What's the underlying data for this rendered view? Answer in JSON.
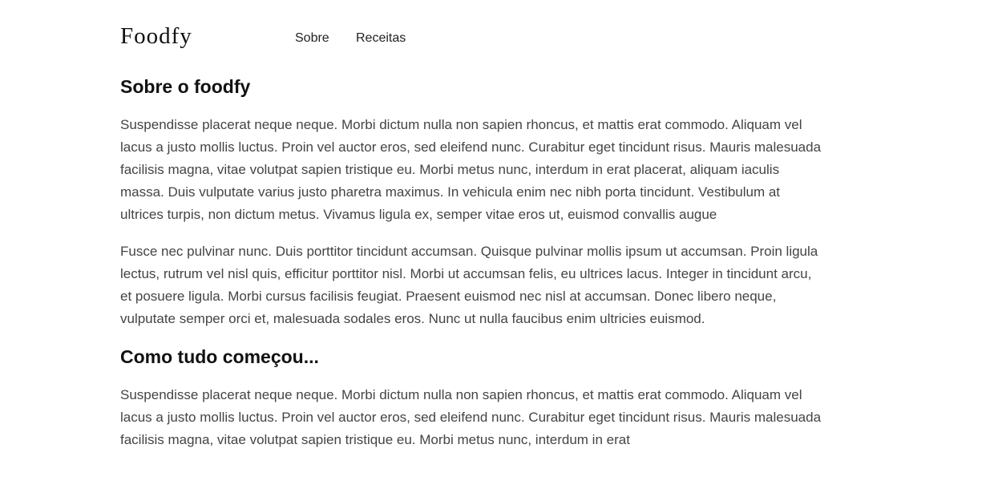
{
  "header": {
    "logo": "Foodfy",
    "nav": {
      "about": "Sobre",
      "recipes": "Receitas"
    }
  },
  "main": {
    "about_title": "Sobre o foodfy",
    "about_paragraphs": [
      "Suspendisse placerat neque neque. Morbi dictum nulla non sapien rhoncus, et mattis erat commodo. Aliquam vel lacus a justo mollis luctus. Proin vel auctor eros, sed eleifend nunc. Curabitur eget tincidunt risus. Mauris malesuada facilisis magna, vitae volutpat sapien tristique eu. Morbi metus nunc, interdum in erat placerat, aliquam iaculis massa. Duis vulputate varius justo pharetra maximus. In vehicula enim nec nibh porta tincidunt. Vestibulum at ultrices turpis, non dictum metus. Vivamus ligula ex, semper vitae eros ut, euismod convallis augue",
      "Fusce nec pulvinar nunc. Duis porttitor tincidunt accumsan. Quisque pulvinar mollis ipsum ut accumsan. Proin ligula lectus, rutrum vel nisl quis, efficitur porttitor nisl. Morbi ut accumsan felis, eu ultrices lacus. Integer in tincidunt arcu, et posuere ligula. Morbi cursus facilisis feugiat. Praesent euismod nec nisl at accumsan. Donec libero neque, vulputate semper orci et, malesuada sodales eros. Nunc ut nulla faucibus enim ultricies euismod."
    ],
    "history_title": "Como tudo começou...",
    "history_paragraphs": [
      "Suspendisse placerat neque neque. Morbi dictum nulla non sapien rhoncus, et mattis erat commodo. Aliquam vel lacus a justo mollis luctus. Proin vel auctor eros, sed eleifend nunc. Curabitur eget tincidunt risus. Mauris malesuada facilisis magna, vitae volutpat sapien tristique eu. Morbi metus nunc, interdum in erat"
    ]
  },
  "colors": {
    "heading": "#111111",
    "body_text": "#444444",
    "background": "#ffffff"
  }
}
